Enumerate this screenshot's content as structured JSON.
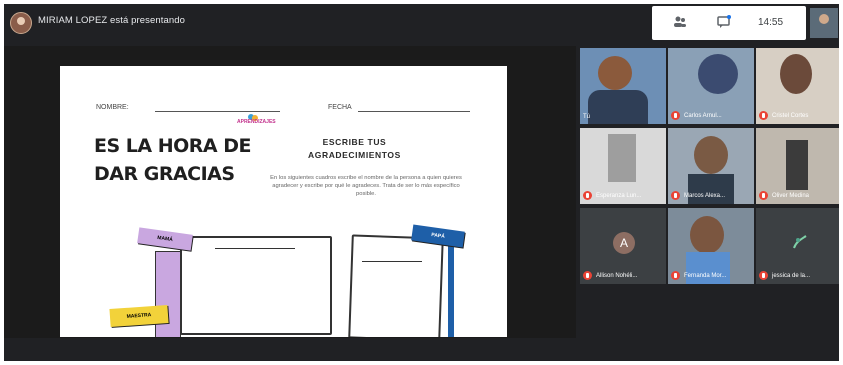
{
  "topbar": {
    "presenter_text": "MIRIAM LOPEZ está presentando",
    "time": "14:55",
    "participants_icon": "people-icon",
    "chat_icon": "chat-icon"
  },
  "slide": {
    "name_label": "NOMBRE:",
    "date_label": "FECHA",
    "title_line1": "ES LA HORA DE",
    "title_line2": "DAR GRACIAS",
    "brand": "APRENDIZAJES",
    "subtitle_line1": "ESCRIBE TUS",
    "subtitle_line2": "AGRADECIMIENTOS",
    "instructions": "En los siguientes cuadros escribe el nombre de la persona a quien quieres agradecer y escribe por qué le agradeces. Trata de ser lo más específico posible.",
    "sign_mama": "MAMÁ",
    "sign_papa": "PAPÁ",
    "sign_maestra": "MAESTRA"
  },
  "participants": [
    {
      "name": "Tú"
    },
    {
      "name": "Carlos Arnul..."
    },
    {
      "name": "Cristel Cortes"
    },
    {
      "name": "Esperanza Lun..."
    },
    {
      "name": "Marcos Alexa..."
    },
    {
      "name": "Oliver Medina"
    },
    {
      "name": "Allison Nohéli...",
      "initial": "A"
    },
    {
      "name": "Fernanda Mor..."
    },
    {
      "name": "jessica de la..."
    }
  ],
  "colors": {
    "background": "#202124",
    "mic_muted": "#ea4335",
    "sign_mama": "#c9a7e0",
    "sign_papa": "#1e5fa8",
    "sign_maestra": "#f2d23a"
  }
}
